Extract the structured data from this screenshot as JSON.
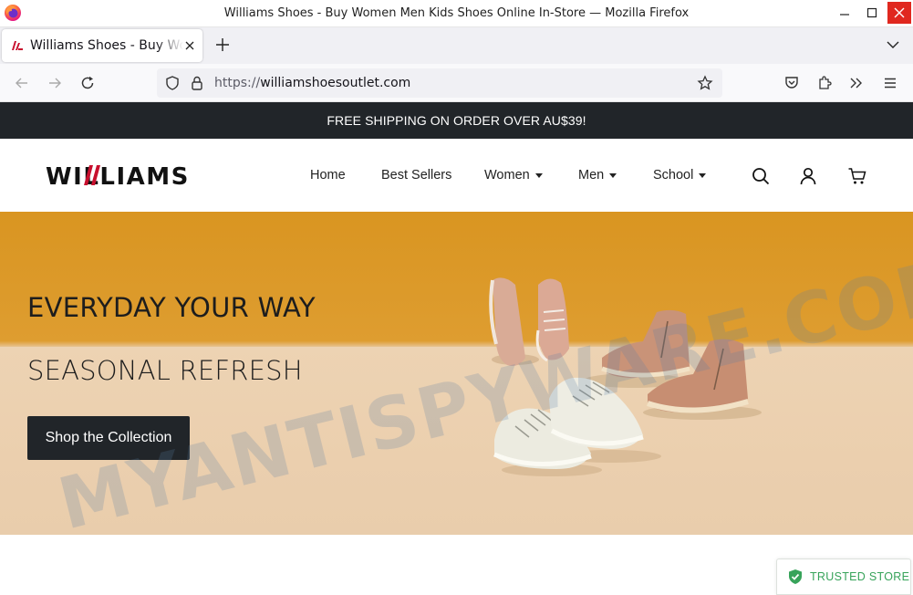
{
  "window": {
    "title": "Williams Shoes - Buy Women Men Kids Shoes Online In-Store — Mozilla Firefox",
    "controls": [
      "minimize",
      "maximize",
      "close"
    ]
  },
  "tab": {
    "title": "Williams Shoes - Buy Women Men Kids Shoes Online In-Store",
    "favicon": "williams-favicon"
  },
  "navbar": {
    "url_protocol": "https://",
    "url_host": "williamshoesoutlet.com"
  },
  "site": {
    "promo": "FREE SHIPPING ON ORDER OVER AU$39!",
    "logo_text": "WILLIAMS",
    "menu": [
      {
        "label": "Home",
        "dropdown": false
      },
      {
        "label": "Best Sellers",
        "dropdown": false
      },
      {
        "label": "Women",
        "dropdown": true
      },
      {
        "label": "Men",
        "dropdown": true
      },
      {
        "label": "School",
        "dropdown": true
      }
    ],
    "icons": [
      "search-icon",
      "account-icon",
      "cart-icon"
    ]
  },
  "hero": {
    "headline": "EVERYDAY YOUR WAY",
    "subheadline": "SEASONAL REFRESH",
    "cta": "Shop the Collection"
  },
  "watermark": "MYANTISPYWARE.COM",
  "badge": {
    "label": "TRUSTED STORE"
  },
  "colors": {
    "dark": "#212529",
    "hero_top": "#d99521",
    "hero_floor": "#edd3b3",
    "trusted_green": "#37a35a",
    "close_red": "#e0281f",
    "logo_red": "#c8102e"
  }
}
